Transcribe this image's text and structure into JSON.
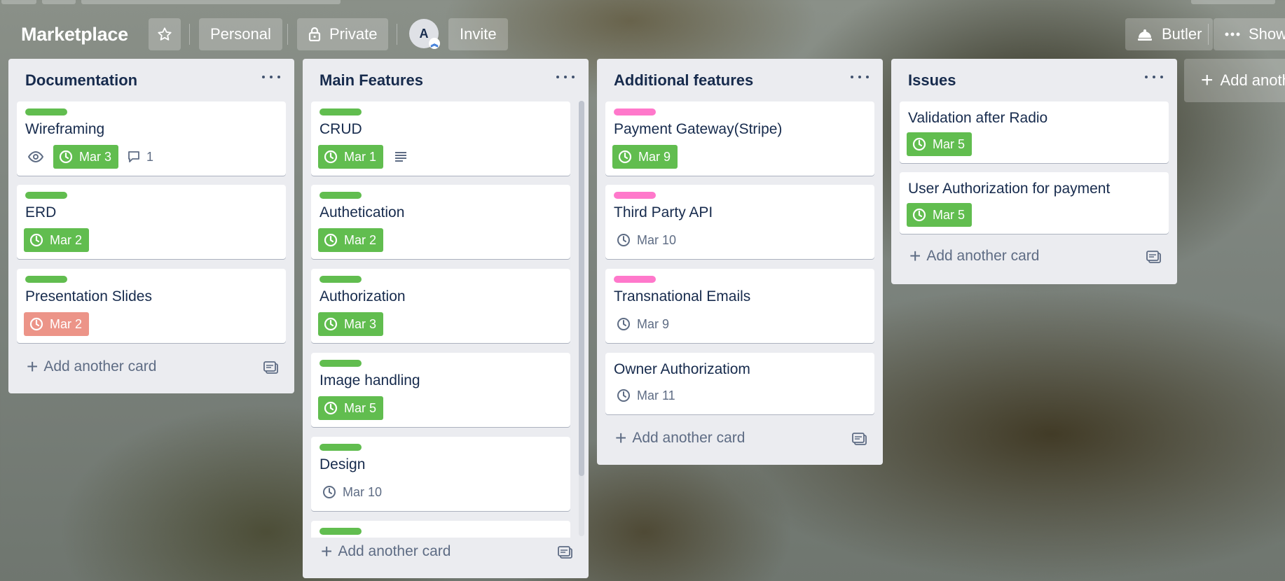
{
  "board": {
    "title": "Marketplace",
    "team_label": "Personal",
    "visibility_label": "Private",
    "member_initial": "A",
    "invite_label": "Invite",
    "butler_label": "Butler",
    "show_menu_label": "Show"
  },
  "lists": [
    {
      "title": "Documentation",
      "add_card_label": "Add another card",
      "cards": [
        {
          "title": "Wireframing",
          "label_color": "#61bd4f",
          "due": "Mar 3",
          "due_state": "complete",
          "watching": true,
          "comments": "1"
        },
        {
          "title": "ERD",
          "label_color": "#61bd4f",
          "due": "Mar 2",
          "due_state": "complete"
        },
        {
          "title": "Presentation Slides",
          "label_color": "#61bd4f",
          "due": "Mar 2",
          "due_state": "overdue"
        }
      ]
    },
    {
      "title": "Main Features",
      "add_card_label": "Add another card",
      "cards": [
        {
          "title": "CRUD",
          "label_color": "#61bd4f",
          "due": "Mar 1",
          "due_state": "complete",
          "has_description": true
        },
        {
          "title": "Authetication",
          "label_color": "#61bd4f",
          "due": "Mar 2",
          "due_state": "complete"
        },
        {
          "title": "Authorization",
          "label_color": "#61bd4f",
          "due": "Mar 3",
          "due_state": "complete"
        },
        {
          "title": "Image handling",
          "label_color": "#61bd4f",
          "due": "Mar 5",
          "due_state": "complete"
        },
        {
          "title": "Design",
          "label_color": "#61bd4f",
          "due": "Mar 10",
          "due_state": "upcoming"
        }
      ]
    },
    {
      "title": "Additional features",
      "add_card_label": "Add another card",
      "cards": [
        {
          "title": "Payment Gateway(Stripe)",
          "label_color": "#ff78cb",
          "due": "Mar 9",
          "due_state": "complete"
        },
        {
          "title": "Third Party API",
          "label_color": "#ff78cb",
          "due": "Mar 10",
          "due_state": "upcoming"
        },
        {
          "title": "Transnational Emails",
          "label_color": "#ff78cb",
          "due": "Mar 9",
          "due_state": "upcoming"
        },
        {
          "title": "Owner Authorizatiom",
          "due": "Mar 11",
          "due_state": "upcoming"
        }
      ]
    },
    {
      "title": "Issues",
      "add_card_label": "Add another card",
      "cards": [
        {
          "title": "Validation after Radio",
          "due": "Mar 5",
          "due_state": "complete"
        },
        {
          "title": "User Authorization for payment",
          "due": "Mar 5",
          "due_state": "complete"
        }
      ]
    }
  ],
  "add_list_label": "Add anoth",
  "colors": {
    "label_green": "#61bd4f",
    "label_pink": "#ff78cb",
    "due_complete": "#61bd4f",
    "due_overdue": "#ec9488"
  }
}
